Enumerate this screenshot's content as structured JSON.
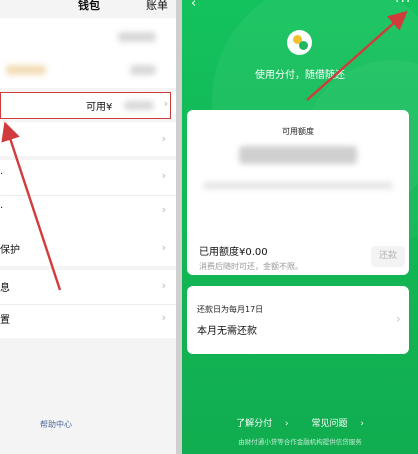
{
  "left": {
    "title": "钱包",
    "bill": "账单",
    "available_prefix": "可用¥",
    "rows": [
      {
        "label": "",
        "chev": "›"
      },
      {
        "label": "",
        "chev": "›"
      },
      {
        "label": "",
        "chev": "›"
      },
      {
        "label": "保护",
        "chev": "›"
      },
      {
        "label": "息",
        "chev": "›"
      },
      {
        "label": "置",
        "chev": "›"
      }
    ],
    "help": "帮助中心"
  },
  "right": {
    "back": "‹",
    "more": "···",
    "tagline": "使用分付，随借随还",
    "available_label": "可用额度",
    "used_label": "已用额度¥0.00",
    "used_sub": "消费后随时可还，金额不限。",
    "repay_button": "还款",
    "repay_date": "还款日为每月17日",
    "repay_status": "本月无需还款",
    "footer_links": [
      "了解分付",
      "常见问题"
    ],
    "footer_chev": "›",
    "disclaimer": "由财付通小贷等合作金融机构提供信贷服务"
  },
  "colors": {
    "green": "#13c25c",
    "annotation_red": "#d23b3b"
  }
}
